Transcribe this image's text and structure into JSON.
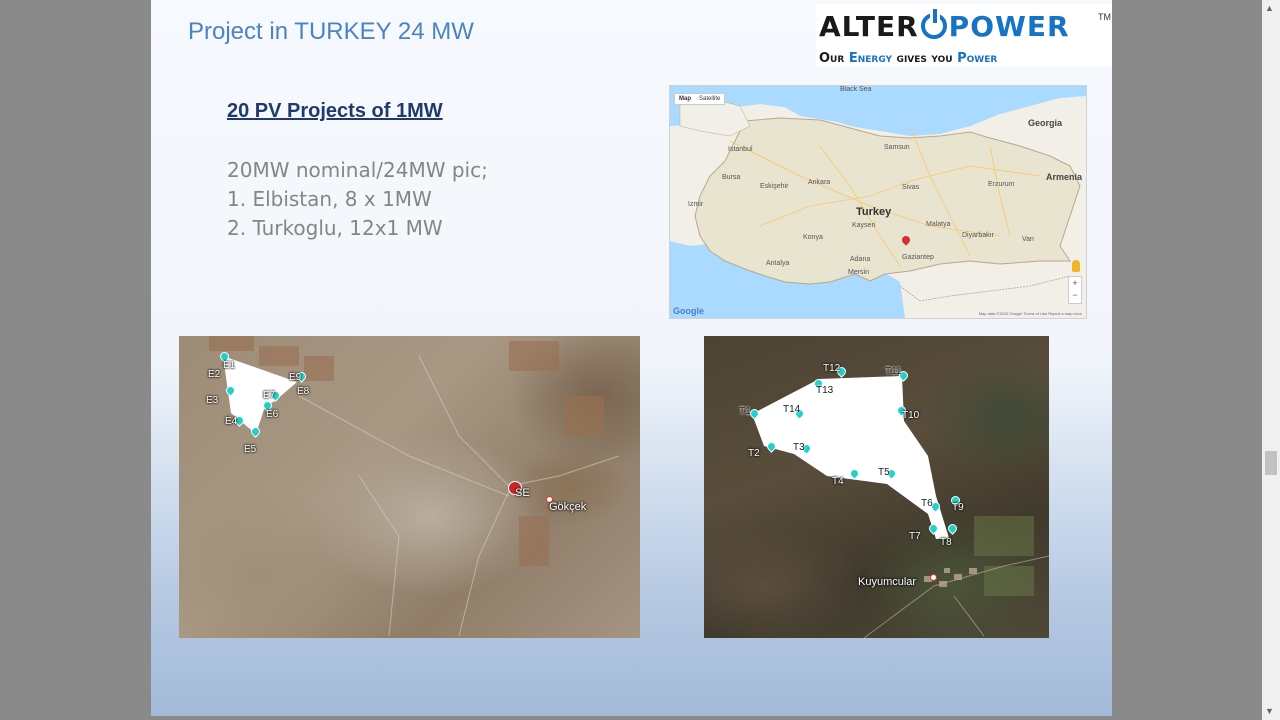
{
  "slide": {
    "title": "Project in TURKEY 24 MW",
    "subtitle": "20 PV Projects of  1MW",
    "lines": [
      "20MW nominal/24MW pic;",
      "1. Elbistan, 8 x 1MW",
      "2. Turkoglu, 12x1 MW"
    ]
  },
  "logo": {
    "brand_left": "ALTER",
    "brand_right": "POWER",
    "tm": "TM",
    "tagline_parts": [
      "Our ",
      "Energy",
      " gives you ",
      "Power"
    ]
  },
  "map": {
    "tabs": [
      "Map",
      "Satellite"
    ],
    "sea_label": "Black Sea",
    "labels": [
      "Turkey",
      "Georgia",
      "Armenia",
      "Istanbul",
      "Ankara",
      "Kayseri",
      "Konya",
      "Antalya",
      "Adana",
      "Mersin",
      "Gaziantep",
      "Malatya",
      "Diyarbakır",
      "Bursa",
      "Izmir",
      "Eskişehir",
      "Samsun",
      "Sivas",
      "Erzurum",
      "Van"
    ],
    "google": "Google",
    "footer": "Map data ©2015 Google   Terms of Use   Report a map error",
    "zoom_in": "+",
    "zoom_out": "−"
  },
  "elbistan": {
    "markers": [
      "E1",
      "E2",
      "E3",
      "E4",
      "E5",
      "E6",
      "E7",
      "E8"
    ],
    "marker_extra": "E9",
    "substation": "SE",
    "place": "Gökçek"
  },
  "turkoglu": {
    "markers": [
      "T1",
      "T2",
      "T3",
      "T4",
      "T5",
      "T6",
      "T7",
      "T8",
      "T9",
      "T10",
      "T11",
      "T12",
      "T13",
      "T14"
    ],
    "place": "Kuyumcular"
  },
  "colors": {
    "title": "#4a84c4",
    "subtitle": "#1f3a6b",
    "body_text": "#858585",
    "logo_blue": "#1673c5",
    "marker": "#1fd2c9"
  },
  "icons": {
    "map_pin": "map-pin-icon",
    "scroll_up": "▲",
    "scroll_down": "▼"
  }
}
